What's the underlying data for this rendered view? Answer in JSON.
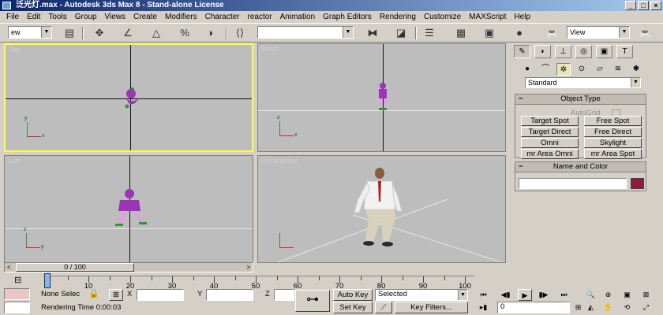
{
  "window": {
    "title": "泛光灯.max - Autodesk 3ds Max 8  - Stand-alone License",
    "minimize": "_",
    "maximize": "□",
    "close": "×"
  },
  "menu": [
    "File",
    "Edit",
    "Tools",
    "Group",
    "Views",
    "Create",
    "Modifiers",
    "Character",
    "reactor",
    "Animation",
    "Graph Editors",
    "Rendering",
    "Customize",
    "MAXScript",
    "Help"
  ],
  "toolbar": {
    "selection_filter": "ew",
    "named_sel": "",
    "view_combo": "View"
  },
  "viewports": [
    {
      "label": "Top",
      "active": true
    },
    {
      "label": "Front",
      "active": false
    },
    {
      "label": "Left",
      "active": false
    },
    {
      "label": "Perspective",
      "active": false
    }
  ],
  "command_panel": {
    "category": "Standard",
    "object_type": {
      "header": "Object Type",
      "autogrid": "AutoGrid",
      "buttons": [
        "Target Spot",
        "Free Spot",
        "Target Direct",
        "Free Direct",
        "Omni",
        "Skylight",
        "mr Area Omni",
        "mr Area Spot"
      ]
    },
    "name_color": {
      "header": "Name and Color",
      "name": "",
      "color": "#8c1d40"
    }
  },
  "timeline": {
    "frame_display": "0 / 100",
    "ticks": [
      "0",
      "10",
      "20",
      "30",
      "40",
      "50",
      "60",
      "70",
      "80",
      "90",
      "100"
    ],
    "current_frame": 0
  },
  "status": {
    "selection": "None Selec",
    "x_label": "X",
    "y_label": "Y",
    "z_label": "Z",
    "rendering_time": "Rendering Time  0:00:03",
    "auto_key": "Auto Key",
    "set_key": "Set Key",
    "key_mode": "Selected",
    "key_filters": "Key Filters...",
    "frame_field": "0"
  }
}
